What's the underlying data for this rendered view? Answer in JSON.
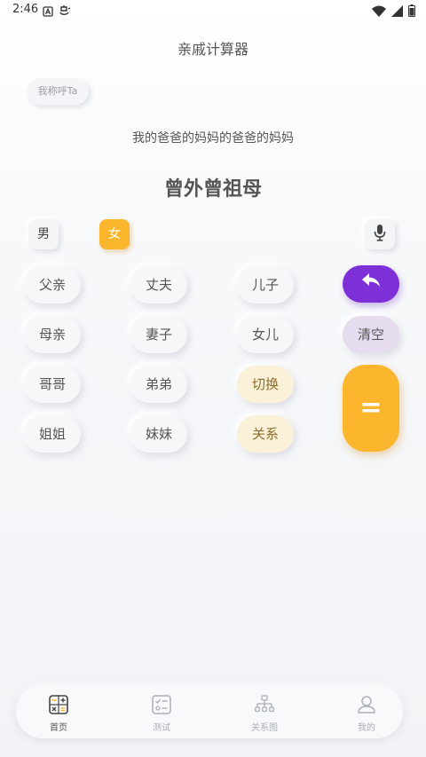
{
  "status_bar": {
    "time": "2:46",
    "left_icons": [
      "notification-a-icon",
      "bug-icon"
    ],
    "right_icons": [
      "wifi-icon",
      "signal-icon",
      "battery-icon"
    ]
  },
  "app": {
    "title": "亲戚计算器"
  },
  "call_chip": {
    "label": "我称呼Ta"
  },
  "expression": "我的爸爸的妈妈的爸爸的妈妈",
  "result": "曾外曾祖母",
  "gender": {
    "male": "男",
    "female": "女",
    "selected": "female"
  },
  "keys": {
    "father": "父亲",
    "husband": "丈夫",
    "son": "儿子",
    "mother": "母亲",
    "wife": "妻子",
    "daughter": "女儿",
    "clear": "清空",
    "elder_brother": "哥哥",
    "younger_brother": "弟弟",
    "switch": "切换",
    "elder_sister": "姐姐",
    "younger_sister": "妹妹",
    "relation": "关系",
    "equals": "="
  },
  "nav": {
    "items": [
      {
        "label": "首页",
        "icon": "calculator-icon",
        "active": true
      },
      {
        "label": "测试",
        "icon": "checklist-icon",
        "active": false
      },
      {
        "label": "关系图",
        "icon": "org-chart-icon",
        "active": false
      },
      {
        "label": "我的",
        "icon": "user-icon",
        "active": false
      }
    ]
  },
  "colors": {
    "accent_yellow": "#fbb62d",
    "accent_purple": "#7d2fd8",
    "clear_lavender": "#e6dcf0",
    "cream": "#fbf1d9"
  }
}
